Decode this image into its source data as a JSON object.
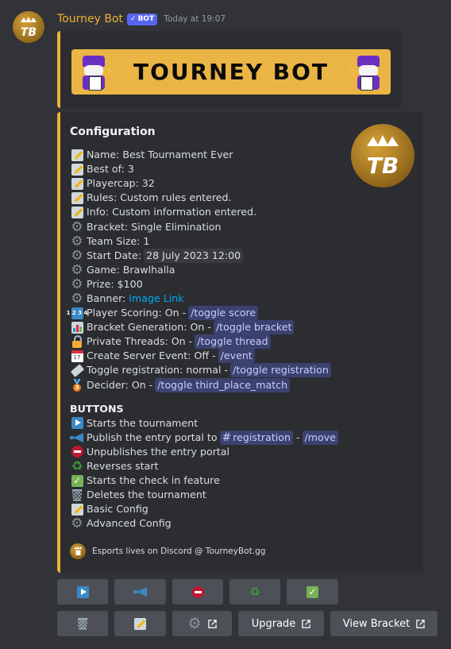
{
  "message": {
    "username": "Tourney Bot",
    "bot_tag": "BOT",
    "timestamp": "Today at 19:07",
    "brand_color": "#f0b132"
  },
  "banner": {
    "title": "TOURNEY BOT",
    "background": "#eab544"
  },
  "embed": {
    "title": "Configuration",
    "thumbnail_text": "TB",
    "config_lines": [
      {
        "icon": "memo",
        "text": "Name: Best Tournament Ever"
      },
      {
        "icon": "memo",
        "text": "Best of: 3"
      },
      {
        "icon": "memo",
        "text": "Playercap: 32"
      },
      {
        "icon": "memo",
        "text": "Rules: Custom rules entered."
      },
      {
        "icon": "memo",
        "text": "Info: Custom information entered."
      },
      {
        "icon": "gear",
        "text": "Bracket: Single Elimination"
      },
      {
        "icon": "gear",
        "text": "Team Size: 1"
      },
      {
        "icon": "gear",
        "text": "Start Date:",
        "code": "28 July 2023 12:00"
      },
      {
        "icon": "gear",
        "text": "Game: Brawlhalla"
      },
      {
        "icon": "gear",
        "text": "Prize: $100"
      },
      {
        "icon": "gear",
        "text": "Banner:",
        "link": "Image Link"
      },
      {
        "icon": "1234",
        "text": "Player Scoring: On -",
        "command": "/toggle score"
      },
      {
        "icon": "bar-chart",
        "text": "Bracket Generation: On -",
        "command": "/toggle bracket"
      },
      {
        "icon": "lock",
        "text": "Private Threads: On -",
        "command": "/toggle thread"
      },
      {
        "icon": "calendar",
        "text": "Create Server Event: Off -",
        "command": "/event"
      },
      {
        "icon": "ticket",
        "text": "Toggle registration: normal -",
        "command": "/toggle registration"
      },
      {
        "icon": "third-place-medal",
        "text": "Decider: On -",
        "command": "/toggle third_place_match"
      }
    ],
    "buttons_title": "BUTTONS",
    "button_lines": [
      {
        "icon": "play",
        "text": "Starts the tournament"
      },
      {
        "icon": "megaphone",
        "text": "Publish the entry portal to",
        "channel": "registration",
        "separator": "-",
        "command": "/move"
      },
      {
        "icon": "no-entry",
        "text": "Unpublishes the entry portal"
      },
      {
        "icon": "recycle",
        "text": "Reverses start"
      },
      {
        "icon": "check",
        "text": "Starts the check in feature"
      },
      {
        "icon": "wastebasket",
        "text": "Deletes the tournament"
      },
      {
        "icon": "memo",
        "text": "Basic Config"
      },
      {
        "icon": "gear",
        "text": "Advanced Config"
      }
    ],
    "footer": "Esports lives on Discord @ TourneyBot.gg"
  },
  "buttons": {
    "row1": [
      "play",
      "megaphone",
      "no-entry",
      "recycle",
      "check"
    ],
    "row2_icons": [
      "wastebasket",
      "memo",
      "gear"
    ],
    "upgrade_label": "Upgrade",
    "view_bracket_label": "View Bracket"
  }
}
